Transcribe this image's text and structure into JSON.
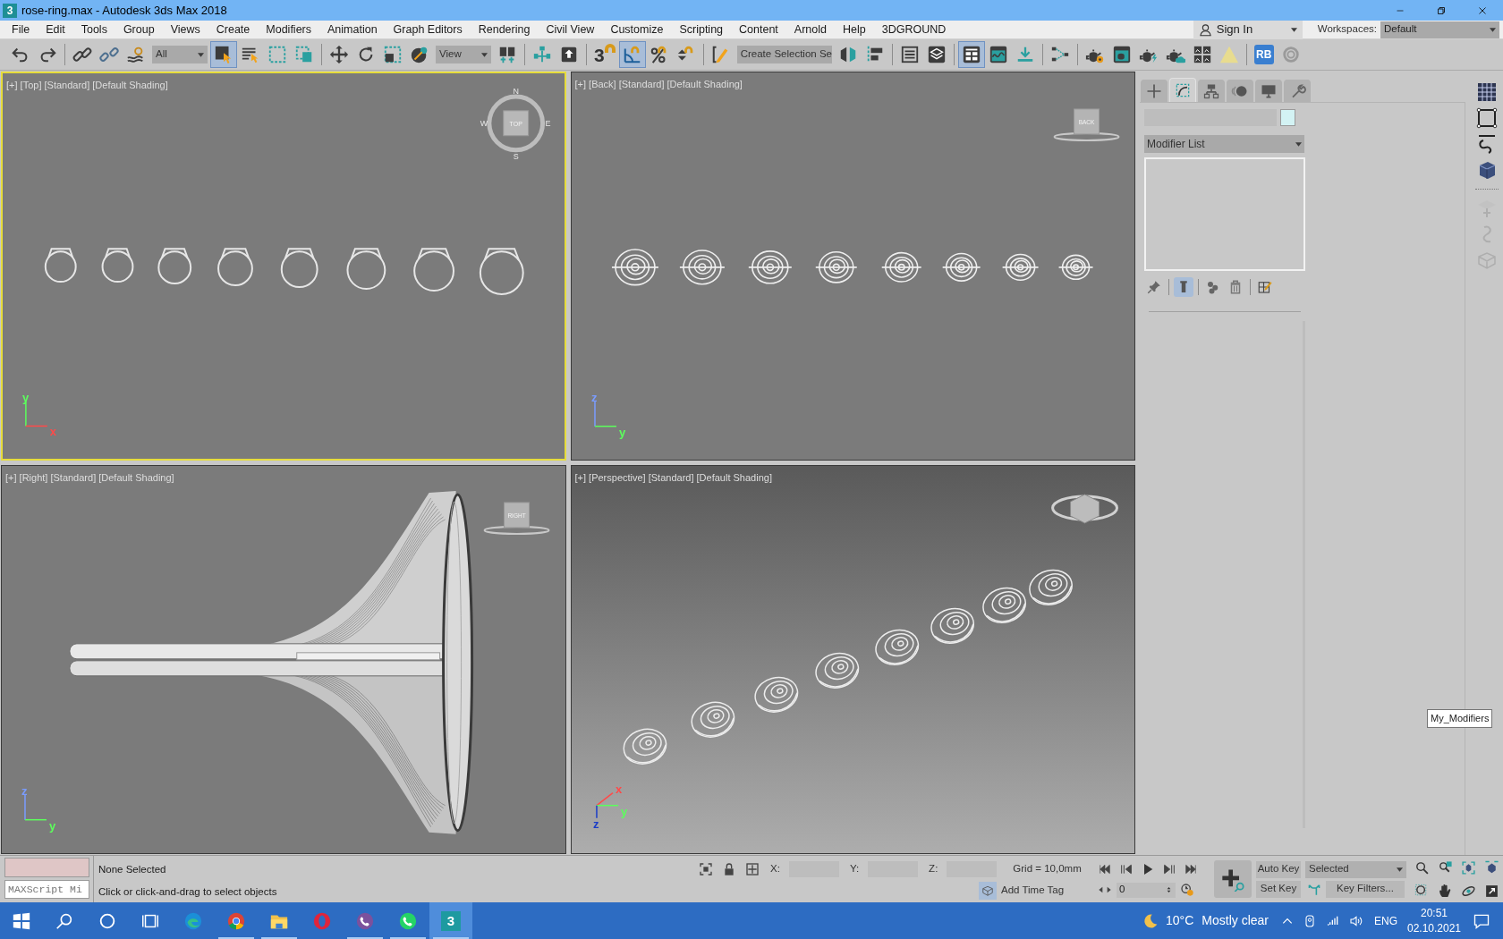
{
  "window": {
    "title": "rose-ring.max - Autodesk 3ds Max 2018",
    "app_icon": "3"
  },
  "menu": [
    "File",
    "Edit",
    "Tools",
    "Group",
    "Views",
    "Create",
    "Modifiers",
    "Animation",
    "Graph Editors",
    "Rendering",
    "Civil View",
    "Customize",
    "Scripting",
    "Content",
    "Arnold",
    "Help",
    "3DGROUND"
  ],
  "account": {
    "label": "Sign In"
  },
  "workspaces": {
    "label": "Workspaces:",
    "value": "Default"
  },
  "toolbar": [
    {
      "kind": "icon",
      "selected": false
    },
    {
      "kind": "icon",
      "selected": false
    },
    {
      "kind": "separator"
    },
    {
      "kind": "icon",
      "selected": false
    },
    {
      "kind": "icon",
      "selected": false
    },
    {
      "kind": "icon",
      "selected": false
    },
    {
      "kind": "dropdown",
      "value": "All"
    },
    {
      "kind": "icon",
      "selected": true
    },
    {
      "kind": "icon",
      "selected": false
    },
    {
      "kind": "icon",
      "selected": false
    },
    {
      "kind": "icon",
      "selected": false
    },
    {
      "kind": "separator"
    },
    {
      "kind": "icon",
      "selected": false
    },
    {
      "kind": "icon",
      "selected": false
    },
    {
      "kind": "icon",
      "selected": false
    },
    {
      "kind": "icon",
      "selected": false
    },
    {
      "kind": "dropdown",
      "value": "View"
    },
    {
      "kind": "icon",
      "selected": false
    },
    {
      "kind": "separator"
    },
    {
      "kind": "icon",
      "selected": false
    },
    {
      "kind": "icon",
      "selected": false
    },
    {
      "kind": "separator"
    },
    {
      "kind": "icon",
      "selected": false,
      "text": "3"
    },
    {
      "kind": "icon",
      "selected": true
    },
    {
      "kind": "icon",
      "selected": false
    },
    {
      "kind": "icon",
      "selected": false
    },
    {
      "kind": "separator"
    },
    {
      "kind": "icon",
      "selected": false
    },
    {
      "kind": "dropdown",
      "value": "Create Selection Se"
    },
    {
      "kind": "icon",
      "selected": false
    },
    {
      "kind": "icon",
      "selected": false
    },
    {
      "kind": "separator"
    },
    {
      "kind": "icon",
      "selected": false
    },
    {
      "kind": "icon",
      "selected": false
    },
    {
      "kind": "separator"
    },
    {
      "kind": "icon",
      "selected": true
    },
    {
      "kind": "icon",
      "selected": false
    },
    {
      "kind": "icon",
      "selected": false
    },
    {
      "kind": "separator"
    },
    {
      "kind": "icon",
      "selected": false
    },
    {
      "kind": "separator"
    },
    {
      "kind": "icon",
      "selected": false
    },
    {
      "kind": "icon",
      "selected": false
    },
    {
      "kind": "icon",
      "selected": false
    },
    {
      "kind": "icon",
      "selected": false
    },
    {
      "kind": "icon",
      "selected": false
    },
    {
      "kind": "icon",
      "selected": false
    },
    {
      "kind": "separator"
    },
    {
      "kind": "icon",
      "selected": false,
      "text": "RB"
    },
    {
      "kind": "icon",
      "selected": false
    }
  ],
  "viewports": [
    {
      "kind": "top",
      "label": "[+] [Top] [Standard] [Default Shading]",
      "active": true,
      "cube_label": "TOP",
      "compass": [
        "N",
        "E",
        "S",
        "W"
      ],
      "axes": [
        {
          "kind": "up",
          "label": "y",
          "color": "#5cff5c"
        },
        {
          "kind": "right",
          "label": "x",
          "color": "#ff4a4a"
        }
      ]
    },
    {
      "kind": "back",
      "label": "[+] [Back] [Standard] [Default Shading]",
      "active": false,
      "cube_label": "BACK",
      "axes": [
        {
          "kind": "up",
          "label": "z",
          "color": "#7a9cff"
        },
        {
          "kind": "right",
          "label": "y",
          "color": "#5cff5c"
        }
      ]
    },
    {
      "kind": "right",
      "label": "[+] [Right] [Standard] [Default Shading]",
      "active": false,
      "cube_label": "RIGHT",
      "axes": [
        {
          "kind": "up",
          "label": "z",
          "color": "#7a9cff"
        },
        {
          "kind": "right",
          "label": "y",
          "color": "#5cff5c"
        }
      ]
    },
    {
      "kind": "perspective",
      "label": "[+] [Perspective] [Standard] [Default Shading]",
      "active": false,
      "axes": [
        {
          "kind": "upright",
          "label": "x",
          "color": "#ff4a4a"
        },
        {
          "kind": "right",
          "label": "y",
          "color": "#5cff5c"
        },
        {
          "kind": "down",
          "label": "z",
          "color": "#1a3cc8"
        }
      ]
    }
  ],
  "command_panel": {
    "tabs": [
      {
        "selected": false
      },
      {
        "selected": true
      },
      {
        "selected": false
      },
      {
        "selected": false
      },
      {
        "selected": false
      },
      {
        "selected": false
      }
    ],
    "color": "#d3f3f4",
    "modifier_list": "Modifier List",
    "stack_buttons": [
      {
        "selected": false
      },
      {
        "selected": true
      },
      {
        "selected": false
      },
      {
        "selected": false
      },
      {
        "selected": false
      }
    ]
  },
  "side_icons": [
    {
      "disabled": false
    },
    {
      "disabled": false
    },
    {
      "disabled": false
    },
    {
      "disabled": false
    },
    {
      "disabled": true
    },
    {
      "disabled": true
    },
    {
      "disabled": true
    }
  ],
  "tooltip": "My_Modifiers",
  "status": {
    "listener": "MAXScript Mi",
    "selection": "None Selected",
    "prompt": "Click or click-and-drag to select objects",
    "coords": [
      "X:",
      "Y:",
      "Z:"
    ],
    "grid": "Grid = 10,0mm",
    "time_tag": "Add Time Tag",
    "frame": "0",
    "auto_key": "Auto Key",
    "set_key": "Set Key",
    "key_mode": "Selected",
    "key_filters": "Key Filters..."
  },
  "taskbar": {
    "apps": [
      {
        "running": false,
        "selected": false
      },
      {
        "running": false,
        "selected": false
      },
      {
        "running": false,
        "selected": false
      },
      {
        "running": false,
        "selected": false
      },
      {
        "running": false,
        "selected": false
      },
      {
        "running": true,
        "selected": false
      },
      {
        "running": true,
        "selected": false
      },
      {
        "running": false,
        "selected": false
      },
      {
        "running": true,
        "selected": false
      },
      {
        "running": true,
        "selected": false
      },
      {
        "running": true,
        "selected": true,
        "text": "3"
      }
    ],
    "temperature": "10°C",
    "weather": "Mostly clear",
    "language": "ENG",
    "time": "20:51",
    "date": "02.10.2021"
  }
}
